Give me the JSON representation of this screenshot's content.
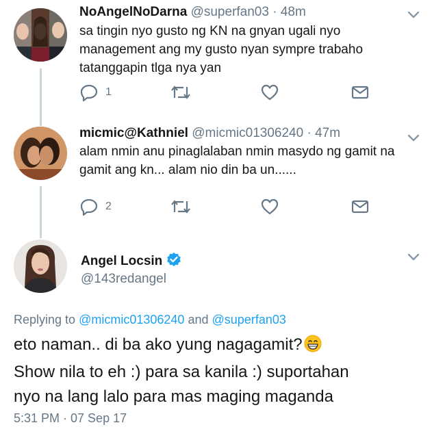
{
  "tweets": [
    {
      "name": "NoAngelNoDarna",
      "handle": "@superfan03",
      "time": "48m",
      "lines": [
        "sa tingin nyo gusto ng KN na gnyan ugali nyo",
        "management ang my gusto nyan sympre trabaho",
        "tatanggapin tlga nya yan"
      ],
      "reply_count": "1",
      "icons": [
        "reply-icon",
        "retweet-icon",
        "like-icon",
        "message-icon"
      ]
    },
    {
      "name": "micmic@Kathniel",
      "handle": "@micmic01306240",
      "time": "47m",
      "lines": [
        "alam nmin anu pinaglalaban nmin masydo ng gamit na",
        "gamit ang kn... alam nio din ba un......"
      ],
      "reply_count": "2",
      "icons": [
        "reply-icon",
        "retweet-icon",
        "like-icon",
        "message-icon"
      ]
    }
  ],
  "focused": {
    "name": "Angel Locsin",
    "handle": "@143redangel",
    "replying_prefix": "Replying to",
    "replying_user1": "@micmic01306240",
    "replying_and": "and",
    "replying_user2": "@superfan03",
    "lines": [
      "eto naman.. di ba ako yung nagagamit?",
      "Show nila to eh :) para sa kanila :) suportahan",
      "nyo na lang lalo para mas maging maganda"
    ],
    "timestamp": "5:31 PM · 07 Sep 17"
  },
  "colors": {
    "accent": "#1da1f2",
    "muted": "#657786",
    "thread_line": "#ccd6dd",
    "verified": "#1da1f2"
  }
}
